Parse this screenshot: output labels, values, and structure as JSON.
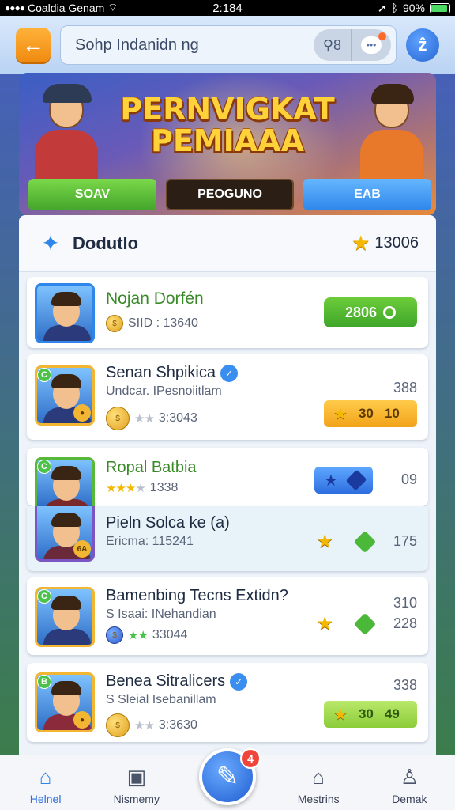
{
  "status_bar": {
    "carrier": "Coaldia Genam",
    "time": "2:184",
    "battery": "90%",
    "battery_level": 0.9
  },
  "header": {
    "back_icon": "arrow-left-icon",
    "search_text": "Sohp Indanidn ng",
    "pill_value": "8",
    "pill_icon": "search-icon",
    "chat_icon": "chat-bubble-icon",
    "profile_icon": "profile-icon"
  },
  "banner": {
    "title_line1": "PERNVIGKAT",
    "title_line2": "PEMIAAA",
    "buttons": [
      "SOAV",
      "PEOGUNO",
      "EAB"
    ]
  },
  "panel": {
    "title": "Dodutlo",
    "score": "13006"
  },
  "rows": [
    {
      "name": "Nojan Dorfén",
      "sub": "SIID : 13640",
      "action": "2806"
    },
    {
      "name": "Senan Shpikica",
      "sub": "Undcar. IPesnoiitlam",
      "number": "388",
      "meta": "3:3043",
      "reward_a": "30",
      "reward_b": "10"
    },
    {
      "name": "Ropal Batbia",
      "meta": "1338",
      "number": "09"
    },
    {
      "name": "Pieln Solca ke (a)",
      "sub": "Ericma: 115241",
      "number": "175"
    },
    {
      "name": "Bamenbing Tecns Extidn?",
      "sub": "S Isaai: INehandian",
      "meta": "33044",
      "number_a": "310",
      "number_b": "228"
    },
    {
      "name": "Benea Sitralicers",
      "sub": "S Sleial  Isebanillam",
      "meta": "3:3630",
      "number": "338",
      "reward_a": "30",
      "reward_b": "49"
    }
  ],
  "bottom_nav": {
    "items": [
      "Helnel",
      "Nismemy",
      "Mestrins",
      "Demak"
    ],
    "center_badge": "4"
  }
}
